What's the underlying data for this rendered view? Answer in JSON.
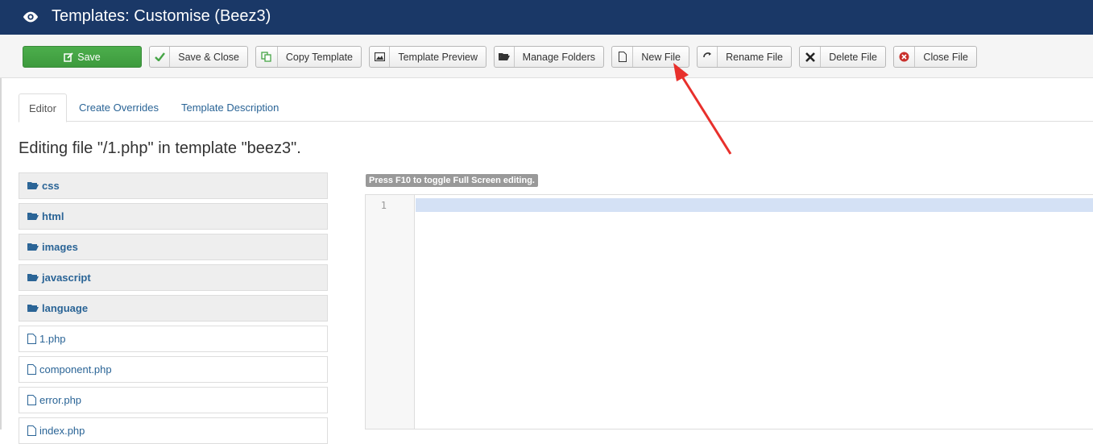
{
  "header": {
    "title": "Templates: Customise (Beez3)",
    "icon": "eye-icon"
  },
  "toolbar": {
    "save": "Save",
    "save_close": "Save & Close",
    "copy_template": "Copy Template",
    "template_preview": "Template Preview",
    "manage_folders": "Manage Folders",
    "new_file": "New File",
    "rename_file": "Rename File",
    "delete_file": "Delete File",
    "close_file": "Close File"
  },
  "tabs": [
    {
      "label": "Editor",
      "active": true
    },
    {
      "label": "Create Overrides",
      "active": false
    },
    {
      "label": "Template Description",
      "active": false
    }
  ],
  "heading": "Editing file \"/1.php\" in template \"beez3\".",
  "tree": {
    "folders": [
      "css",
      "html",
      "images",
      "javascript",
      "language"
    ],
    "files": [
      "1.php",
      "component.php",
      "error.php",
      "index.php"
    ]
  },
  "editor": {
    "hint": "Press F10 to toggle Full Screen editing.",
    "line_number": "1"
  },
  "colors": {
    "header_bg": "#1a3867",
    "save_green": "#46a546",
    "link_blue": "#2a6496",
    "arrow_red": "#e8302c"
  }
}
